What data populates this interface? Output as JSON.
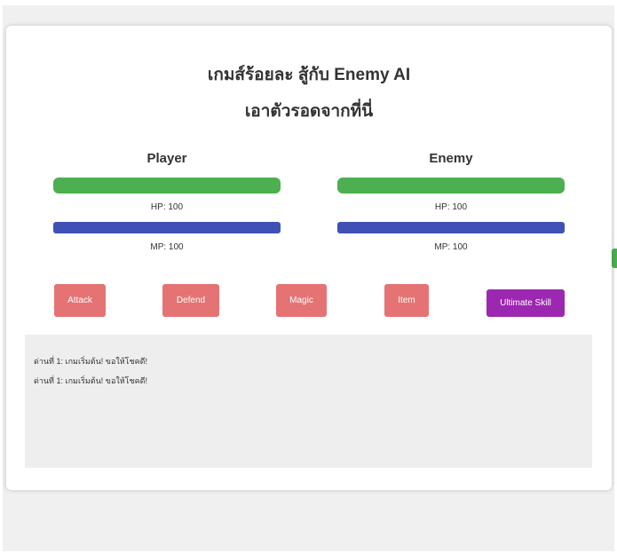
{
  "title_line1": "เกมส์ร้อยละ สู้กับ Enemy AI",
  "title_line2": "เอาตัวรอดจากที่นี่",
  "player": {
    "name": "Player",
    "hp_text": "HP: 100",
    "mp_text": "MP: 100",
    "hp": 100,
    "mp": 100
  },
  "enemy": {
    "name": "Enemy",
    "hp_text": "HP: 100",
    "mp_text": "MP: 100",
    "hp": 100,
    "mp": 100
  },
  "actions": {
    "attack": "Attack",
    "defend": "Defend",
    "magic": "Magic",
    "item": "Item",
    "ultimate": "Ultimate Skill"
  },
  "log": [
    "ด่านที่ 1: เกมเริ่มต้น! ขอให้โชคดี!",
    "ด่านที่ 1: เกมเริ่มต้น! ขอให้โชคดี!"
  ],
  "colors": {
    "hp": "#4caf50",
    "mp": "#3f51b5",
    "action_button": "#e57373",
    "ultimate_button": "#9c27b0",
    "log_background": "#eeeeee",
    "page_background": "#f0f0f0"
  }
}
